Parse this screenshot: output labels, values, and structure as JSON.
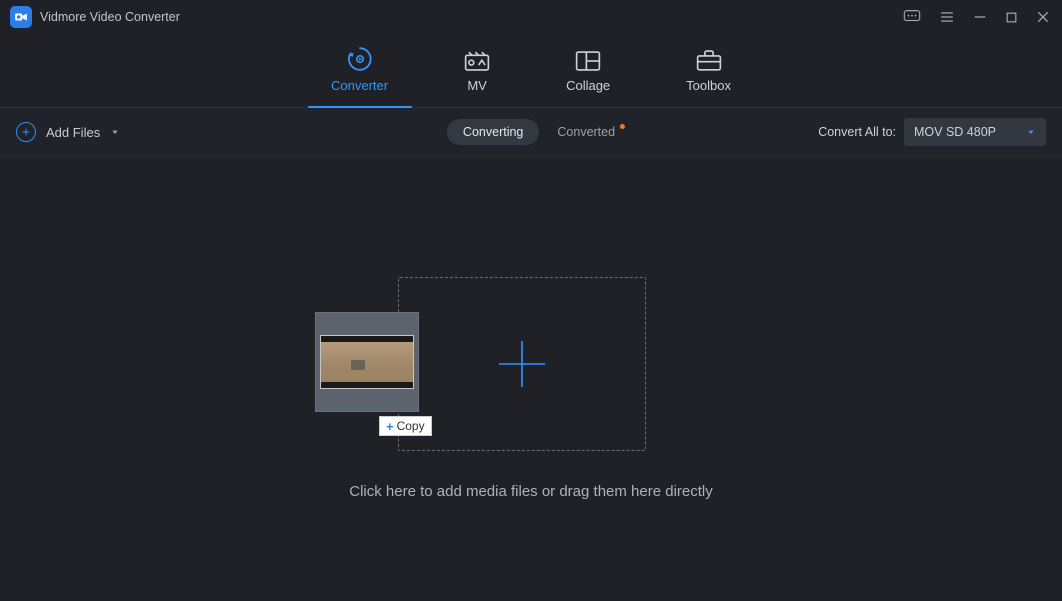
{
  "app": {
    "title": "Vidmore Video Converter"
  },
  "nav": {
    "converter": "Converter",
    "mv": "MV",
    "collage": "Collage",
    "toolbox": "Toolbox"
  },
  "toolbar": {
    "add_files": "Add Files",
    "converting": "Converting",
    "converted": "Converted",
    "convert_all_label": "Convert All to:",
    "format_selected": "MOV SD 480P"
  },
  "main": {
    "instruction": "Click here to add media files or drag them here directly",
    "copy_tag": "Copy"
  }
}
